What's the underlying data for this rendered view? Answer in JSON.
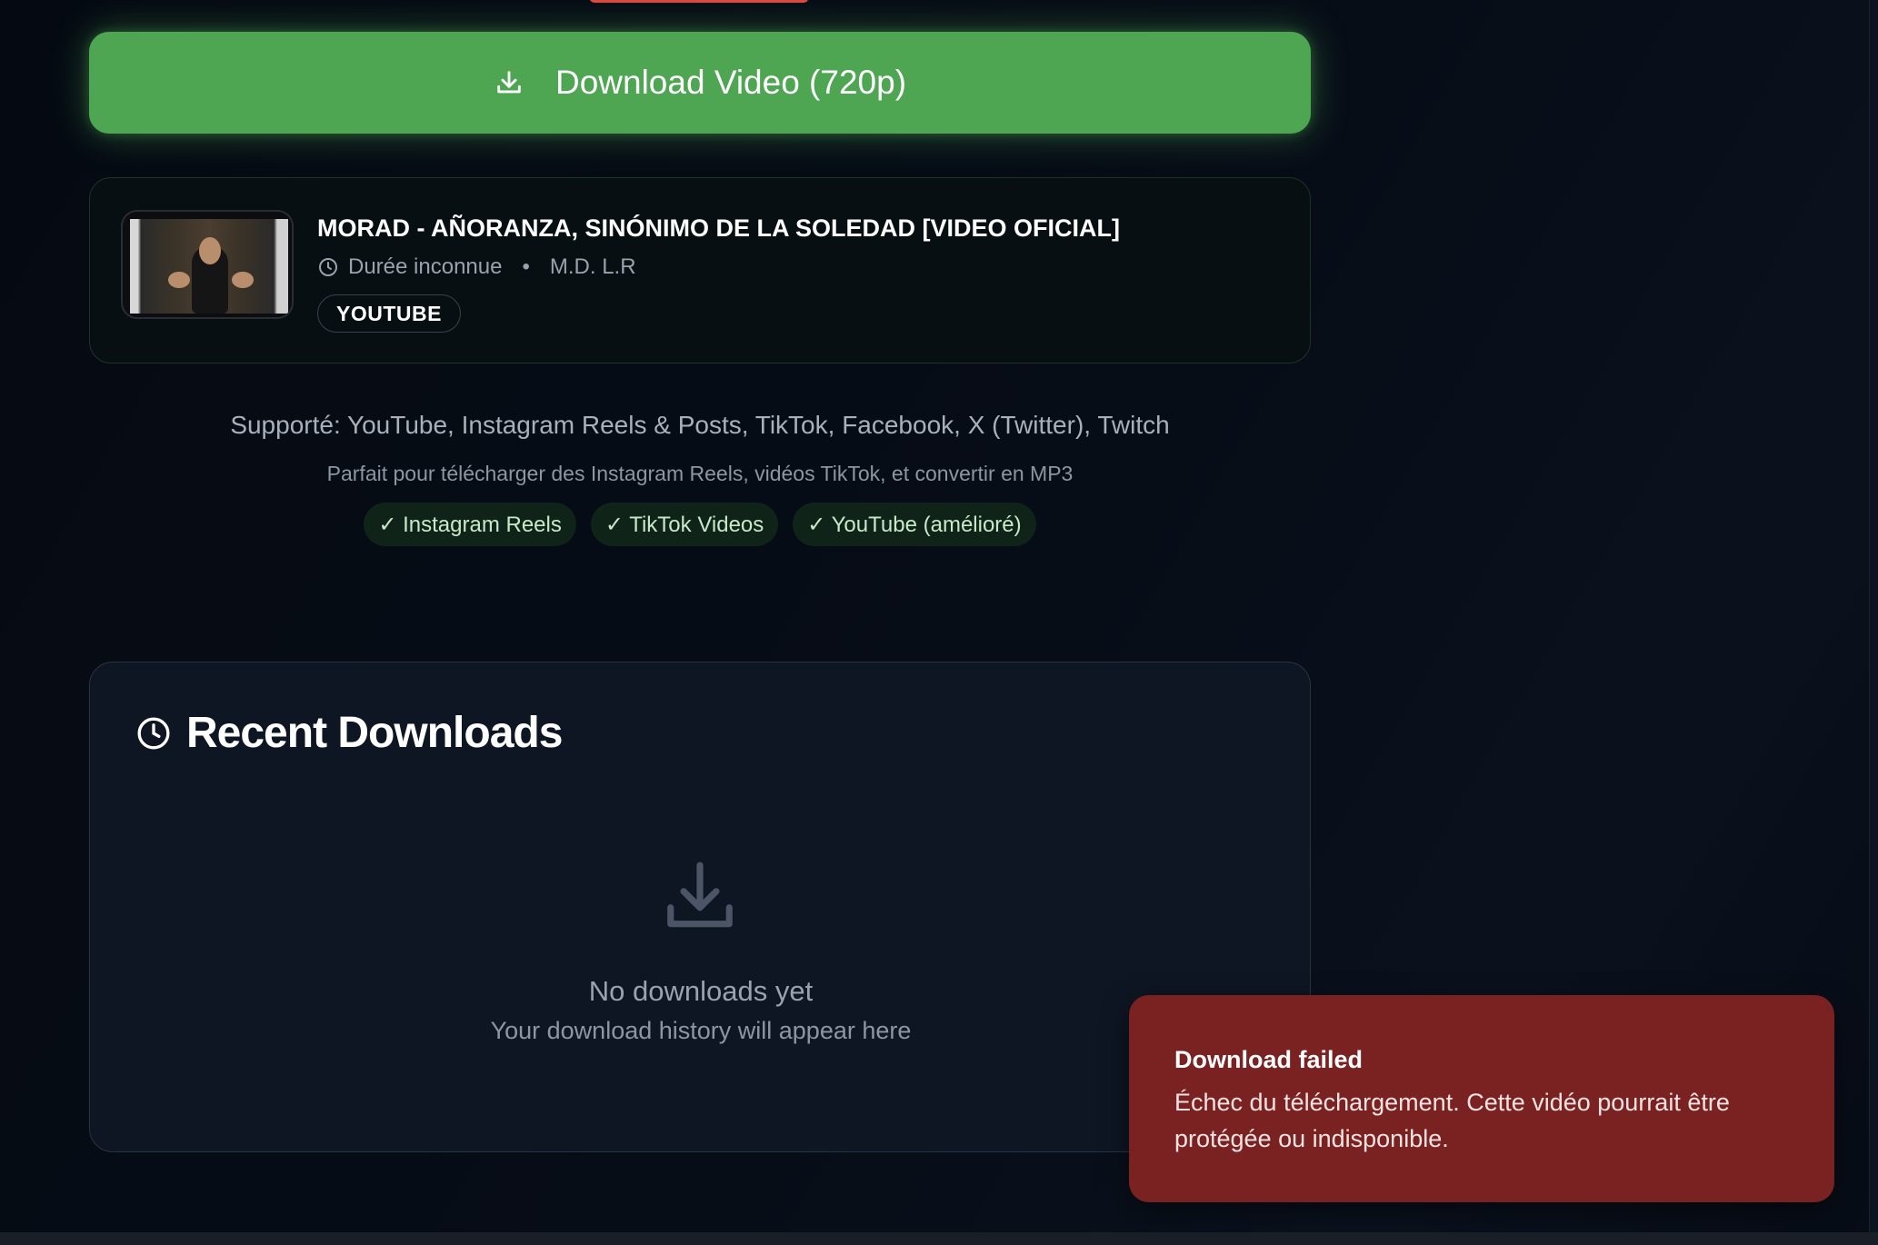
{
  "download_button": {
    "label": "Download Video (720p)",
    "icon": "download-icon",
    "color": "#4ea653"
  },
  "video": {
    "title": "MORAD - AÑORANZA, SINÓNIMO DE LA SOLEDAD [VIDEO OFICIAL]",
    "duration": "Durée inconnue",
    "separator": "•",
    "author": "M.D. L.R",
    "platform": "YOUTUBE"
  },
  "supported": {
    "line": "Supporté: YouTube, Instagram Reels & Posts, TikTok, Facebook, X (Twitter), Twitch",
    "tagline": "Parfait pour télécharger des Instagram Reels, vidéos TikTok, et convertir en MP3",
    "features": [
      "✓ Instagram Reels",
      "✓ TikTok Videos",
      "✓ YouTube (amélioré)"
    ]
  },
  "recent": {
    "title": "Recent Downloads",
    "empty_title": "No downloads yet",
    "empty_subtitle": "Your download history will appear here"
  },
  "toast": {
    "title": "Download failed",
    "message": "Échec du téléchargement. Cette vidéo pourrait être protégée ou indisponible.",
    "color": "#7a2222"
  }
}
